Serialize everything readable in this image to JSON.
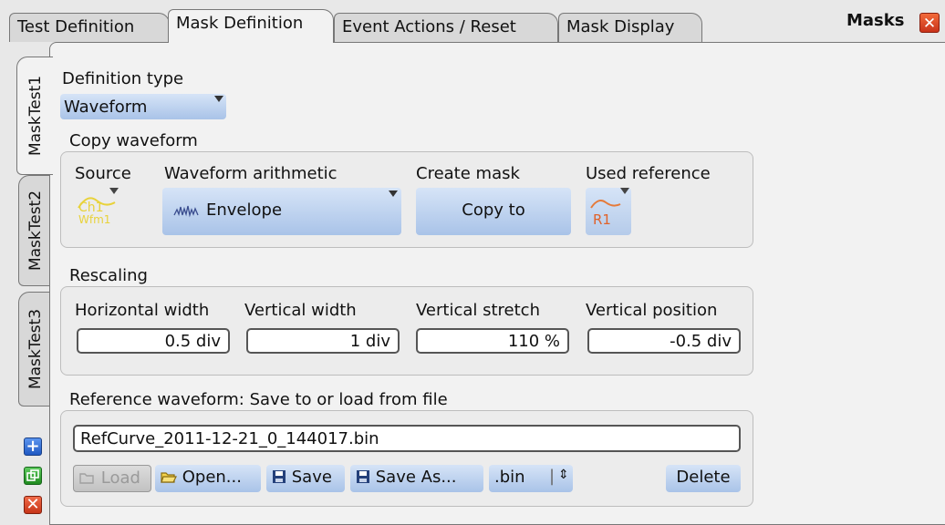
{
  "tabs": [
    {
      "label": "Test Definition"
    },
    {
      "label": "Mask Definition"
    },
    {
      "label": "Event Actions / Reset"
    },
    {
      "label": "Mask Display"
    }
  ],
  "dialog_title": "Masks",
  "side_tabs": [
    "MaskTest1",
    "MaskTest2",
    "MaskTest3"
  ],
  "definition": {
    "label": "Definition type",
    "value": "Waveform"
  },
  "copy_waveform": {
    "label": "Copy waveform",
    "source_label": "Source",
    "source_icon_line1": "Ch1",
    "source_icon_line2": "Wfm1",
    "arith_label": "Waveform arithmetic",
    "arith_value": "Envelope",
    "create_label": "Create mask",
    "create_button": "Copy to",
    "ref_label": "Used reference",
    "ref_icon_text": "R1"
  },
  "rescaling": {
    "label": "Rescaling",
    "fields": [
      {
        "label": "Horizontal width",
        "value": "0.5 div"
      },
      {
        "label": "Vertical width",
        "value": "1 div"
      },
      {
        "label": "Vertical stretch",
        "value": "110 %"
      },
      {
        "label": "Vertical position",
        "value": "-0.5 div"
      }
    ]
  },
  "reference_file": {
    "label": "Reference waveform: Save to or load from file",
    "filename": "RefCurve_2011-12-21_0_144017.bin",
    "load": "Load",
    "open": "Open...",
    "save": "Save",
    "save_as": "Save As...",
    "format": ".bin",
    "delete": "Delete"
  },
  "icons": {
    "add": "plus-icon",
    "copy": "copy-icon",
    "delete": "close-icon",
    "close": "close-icon",
    "accent_blue": "#2f6fd6",
    "accent_green": "#2a9a2a",
    "accent_red": "#d6381c"
  }
}
